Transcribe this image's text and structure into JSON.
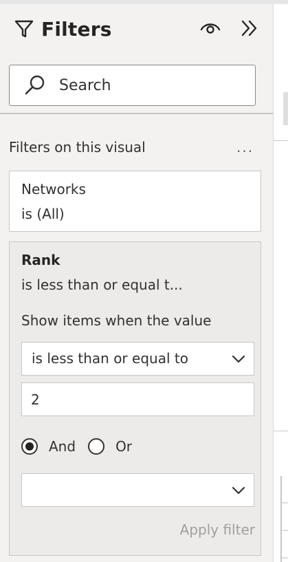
{
  "pane": {
    "title": "Filters",
    "title_icon": "funnel-icon",
    "eye_icon": "eye-icon",
    "collapse_icon": "double-chevron-right-icon"
  },
  "search": {
    "placeholder": "Search",
    "value": ""
  },
  "section": {
    "header": "Filters on this visual",
    "more_label": "..."
  },
  "filters": [
    {
      "field": "Networks",
      "summary": "is (All)"
    },
    {
      "field": "Rank",
      "summary": "is less than or equal t...",
      "show_items_label": "Show items when the value",
      "condition": "is less than or equal to",
      "value": "2",
      "logic_options": [
        {
          "label": "And",
          "checked": true
        },
        {
          "label": "Or",
          "checked": false
        }
      ],
      "second_condition": "",
      "apply_label": "Apply filter"
    }
  ],
  "colors": {
    "pane_background": "#f3f2f1",
    "card_background": "#ffffff",
    "expanded_card_background": "#edebe9",
    "text": "#252423",
    "disabled_text": "#a19f9d",
    "border": "#c8c6c4"
  }
}
